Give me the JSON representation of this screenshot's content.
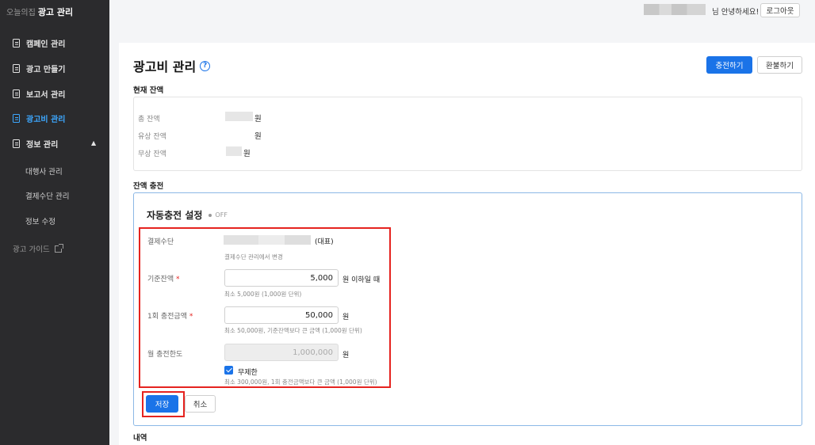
{
  "sidebar": {
    "brand_prefix": "오늘의집",
    "brand_title": "광고 관리",
    "items": [
      {
        "label": "캠페인 관리"
      },
      {
        "label": "광고 만들기"
      },
      {
        "label": "보고서 관리"
      },
      {
        "label": "광고비 관리"
      },
      {
        "label": "정보 관리"
      }
    ],
    "sub_items": [
      {
        "label": "대행사 관리"
      },
      {
        "label": "결제수단 관리"
      },
      {
        "label": "정보 수정"
      }
    ],
    "guide_label": "광고 가이드",
    "active_color": "#3da8ff"
  },
  "header": {
    "greeting": "님 안녕하세요!",
    "logout_label": "로그아웃"
  },
  "page": {
    "title": "광고비 관리",
    "charge_button": "충전하기",
    "refund_button": "환불하기",
    "accent_color": "#1a73e8"
  },
  "balance": {
    "section_label": "현재 잔액",
    "rows": [
      {
        "label": "총 잔액",
        "unit": "원"
      },
      {
        "label": "유상 잔액",
        "unit": "원"
      },
      {
        "label": "무상 잔액",
        "unit": "원"
      }
    ]
  },
  "recharge": {
    "section_label": "잔액 충전",
    "auto_title": "자동충전 설정",
    "status": "OFF",
    "payment_label": "결제수단",
    "payment_tag": "(대표)",
    "payment_hint": "결제수단 관리에서 변경",
    "threshold_label": "기준잔액",
    "threshold_value": "5,000",
    "threshold_unit": "원 이하일 때",
    "threshold_hint": "최소 5,000원 (1,000원 단위)",
    "amount_label": "1회 충전금액",
    "amount_value": "50,000",
    "amount_unit": "원",
    "amount_hint": "최소 50,000원, 기준잔액보다 큰 금액 (1,000원 단위)",
    "limit_label": "월 충전한도",
    "limit_value": "1,000,000",
    "limit_unit": "원",
    "unlimited_label": "무제한",
    "unlimited_checked": true,
    "limit_hint": "최소 300,000원, 1회 충전금액보다 큰 금액 (1,000원 단위)",
    "required_mark": "*",
    "save_label": "저장",
    "cancel_label": "취소",
    "highlight_color": "#e5231f"
  },
  "history": {
    "section_label": "내역"
  }
}
